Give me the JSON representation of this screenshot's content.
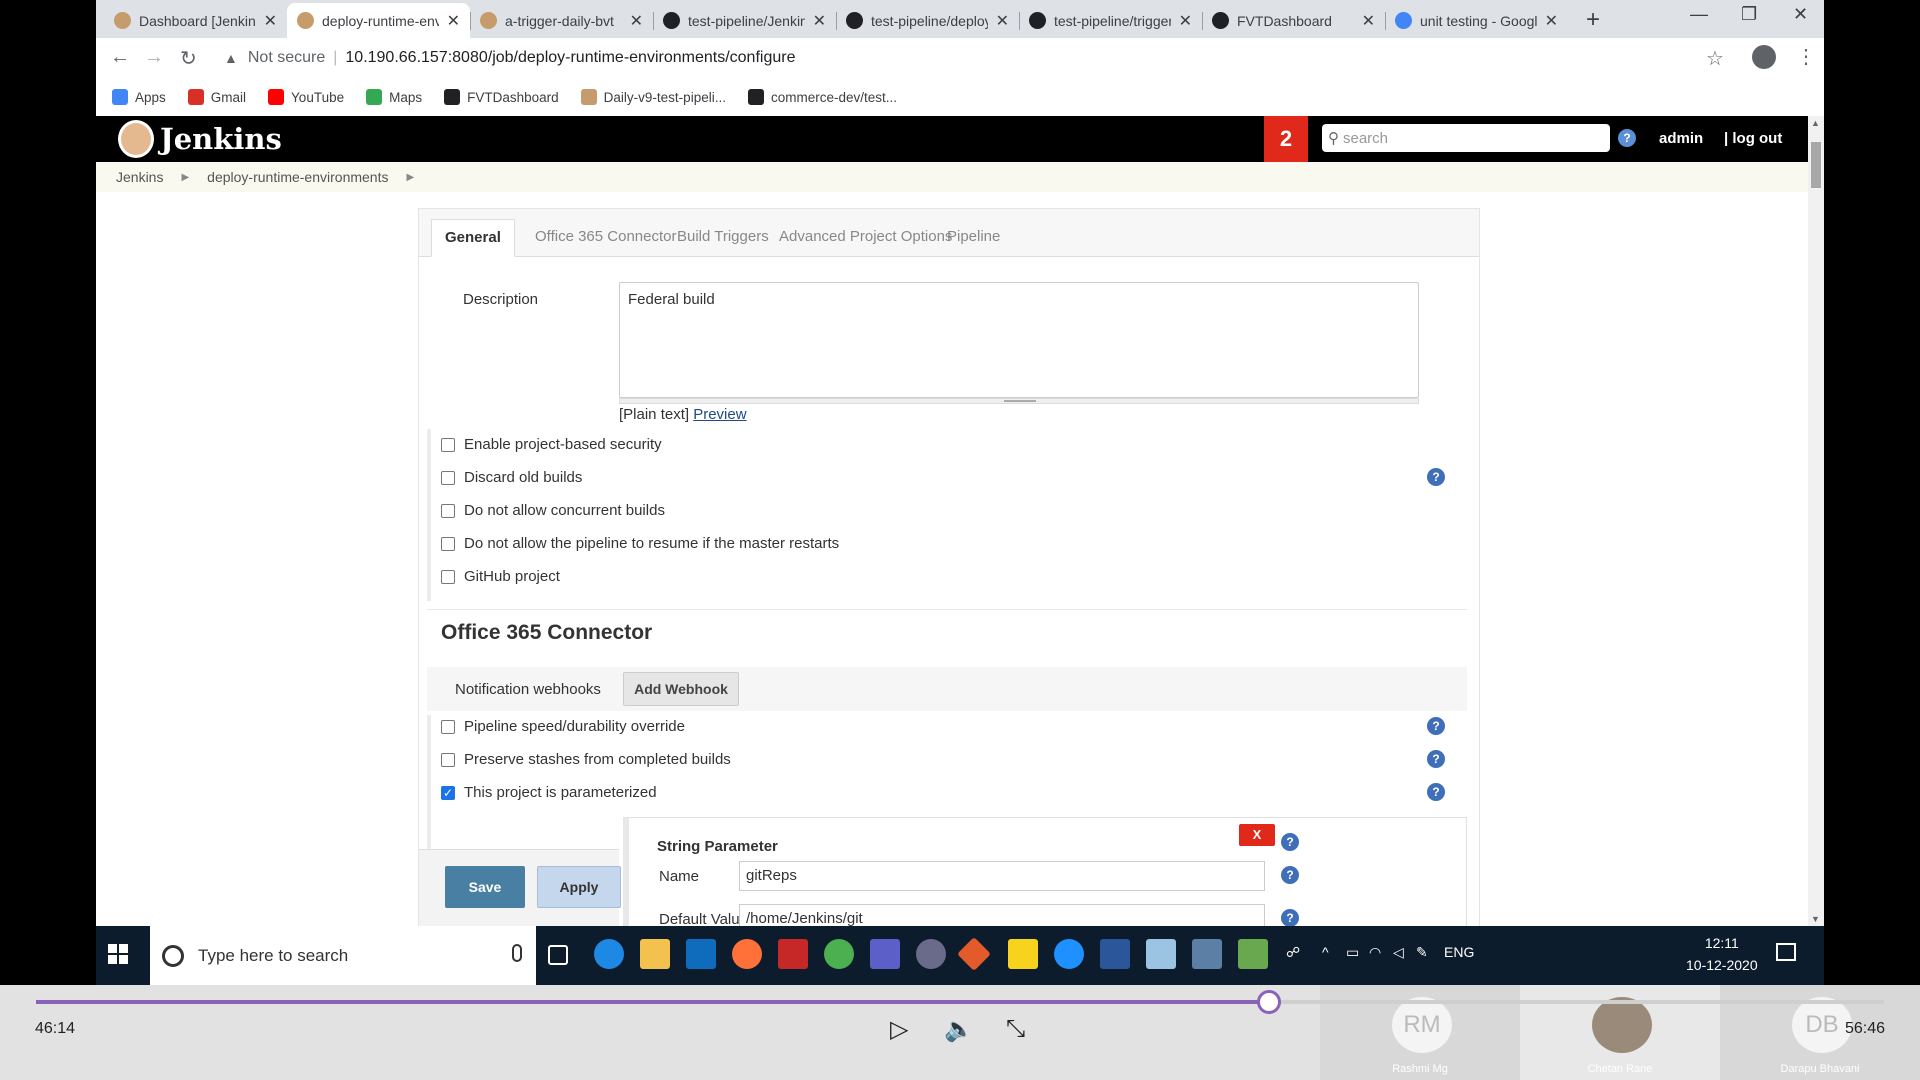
{
  "browser": {
    "tabs": [
      {
        "title": "Dashboard [Jenkins]",
        "active": false
      },
      {
        "title": "deploy-runtime-environments",
        "active": true
      },
      {
        "title": "a-trigger-daily-bvt",
        "active": false
      },
      {
        "title": "test-pipeline/Jenkins",
        "active": false
      },
      {
        "title": "test-pipeline/deploy",
        "active": false
      },
      {
        "title": "test-pipeline/trigger",
        "active": false
      },
      {
        "title": "FVTDashboard",
        "active": false
      },
      {
        "title": "unit testing - Google",
        "active": false
      }
    ],
    "security_label": "Not secure",
    "url": "10.190.66.157:8080/job/deploy-runtime-environments/configure",
    "bookmarks": [
      {
        "label": "Apps",
        "color": "#4285f4"
      },
      {
        "label": "Gmail",
        "color": "#d93025"
      },
      {
        "label": "YouTube",
        "color": "#ff0000"
      },
      {
        "label": "Maps",
        "color": "#34a853"
      },
      {
        "label": "FVTDashboard",
        "color": "#202124"
      },
      {
        "label": "Daily-v9-test-pipeli...",
        "color": "#c69c6d"
      },
      {
        "label": "commerce-dev/test...",
        "color": "#202124"
      }
    ]
  },
  "jenkins": {
    "logo_text": "Jenkins",
    "notification_count": "2",
    "search_placeholder": "search",
    "help_glyph": "?",
    "user": "admin",
    "logout": "| log out",
    "breadcrumb": [
      "Jenkins",
      "deploy-runtime-environments"
    ]
  },
  "config": {
    "tabs": [
      "General",
      "Office 365 Connector",
      "Build Triggers",
      "Advanced Project Options",
      "Pipeline"
    ],
    "description_label": "Description",
    "description_value": "Federal build",
    "plain_text": "[Plain text]",
    "preview_link": "Preview",
    "general_options": [
      {
        "label": "Enable project-based security",
        "checked": false
      },
      {
        "label": "Discard old builds",
        "checked": false
      },
      {
        "label": "Do not allow concurrent builds",
        "checked": false
      },
      {
        "label": "Do not allow the pipeline to resume if the master restarts",
        "checked": false
      },
      {
        "label": "GitHub project",
        "checked": false
      }
    ],
    "office365_title": "Office 365 Connector",
    "notification_webhooks_label": "Notification webhooks",
    "add_webhook_label": "Add Webhook",
    "more_options": [
      {
        "label": "Pipeline speed/durability override",
        "checked": false
      },
      {
        "label": "Preserve stashes from completed builds",
        "checked": false
      },
      {
        "label": "This project is parameterized",
        "checked": true
      }
    ],
    "string_parameter": {
      "title": "String Parameter",
      "delete_label": "X",
      "name_label": "Name",
      "name_value": "gitReps",
      "default_label": "Default Value",
      "default_value": "/home/Jenkins/git"
    },
    "save_label": "Save",
    "apply_label": "Apply"
  },
  "taskbar": {
    "search_placeholder": "Type here to search",
    "language": "ENG",
    "time": "12:11",
    "date": "10-12-2020"
  },
  "player": {
    "current_time": "46:14",
    "end_time": "56:46",
    "progress": 0.667,
    "participants": [
      {
        "initials": "RM",
        "name": "Rashmi Mg"
      },
      {
        "initials": "",
        "name": "Chetan Rane"
      },
      {
        "initials": "DB",
        "name": "Darapu Bhavani"
      }
    ]
  }
}
